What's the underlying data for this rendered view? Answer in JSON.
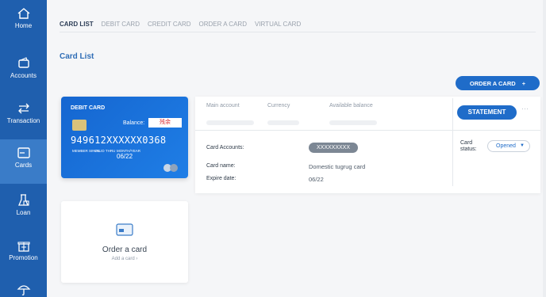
{
  "sidebar": {
    "items": [
      {
        "label": "Home",
        "icon": "home-icon"
      },
      {
        "label": "Accounts",
        "icon": "wallet-icon"
      },
      {
        "label": "Transaction",
        "icon": "transfer-arrows-icon"
      },
      {
        "label": "Cards",
        "icon": "card-icon",
        "active": true
      },
      {
        "label": "Loan",
        "icon": "loan-icon"
      },
      {
        "label": "Promotion",
        "icon": "gift-icon"
      },
      {
        "label": "",
        "icon": "umbrella-icon"
      }
    ]
  },
  "tabs": [
    "CARD LIST",
    "DEBIT CARD",
    "CREDIT CARD",
    "ORDER A CARD",
    "VIRTUAL CARD"
  ],
  "section_title": "Card List",
  "order_button": {
    "label": "ORDER A CARD",
    "icon": "+"
  },
  "debit_card": {
    "title": "DEBIT CARD",
    "balance_label": "Balance:",
    "balance_value": "残余",
    "number": "949612XXXXXX0368",
    "member_since": "MEMBER SINCE",
    "valid_thru": "VALID THRU",
    "month_year": "MONTH/YEAR",
    "expiry": "06/22"
  },
  "order_tile": {
    "title": "Order a card",
    "link": "Add a card  ›"
  },
  "details": {
    "headers": {
      "main_account": "Main account",
      "currency": "Currency",
      "available_balance": "Available balance"
    },
    "statement_label": "STATEMENT",
    "more": "···",
    "card_accounts_label": "Card Accounts:",
    "card_accounts_value": "XXXXXXXXX",
    "card_name_label": "Card name:",
    "card_name_value": "Domestic tugrug card",
    "expire_label": "Expire date:",
    "expire_value": "06/22",
    "status_label": "Card status:",
    "status_value": "Opened"
  },
  "colors": {
    "sidebar": "#1f5fae",
    "accent": "#1f6cc9",
    "card": "#1766d1"
  }
}
